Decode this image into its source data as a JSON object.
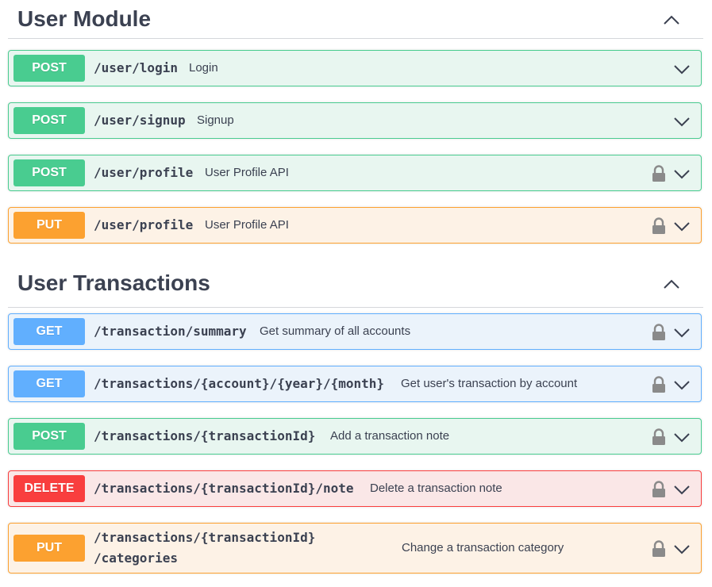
{
  "sections": [
    {
      "title": "User Module",
      "collapse_icon": "chevron-up-icon",
      "operations": [
        {
          "method": "POST",
          "path": "/user/login",
          "summary": "Login",
          "locked": false
        },
        {
          "method": "POST",
          "path": "/user/signup",
          "summary": "Signup",
          "locked": false
        },
        {
          "method": "POST",
          "path": "/user/profile",
          "summary": "User Profile API",
          "locked": true
        },
        {
          "method": "PUT",
          "path": "/user/profile",
          "summary": "User Profile API",
          "locked": true
        }
      ]
    },
    {
      "title": "User Transactions",
      "collapse_icon": "chevron-up-icon",
      "operations": [
        {
          "method": "GET",
          "path": "/transaction/summary",
          "summary": "Get summary of all accounts",
          "locked": true
        },
        {
          "method": "GET",
          "path": "/transactions/{account}/{year}/{month}",
          "summary": "Get user's transaction by account",
          "locked": true
        },
        {
          "method": "POST",
          "path": "/transactions/{transactionId}",
          "summary": "Add a transaction note",
          "locked": true
        },
        {
          "method": "DELETE",
          "path": "/transactions/{transactionId}/note",
          "summary": "Delete a transaction note",
          "locked": true
        },
        {
          "method": "PUT",
          "path_line1": "/transactions/{transactionId}",
          "path_line2": "/categories",
          "summary": "Change a transaction category",
          "locked": true
        }
      ]
    }
  ],
  "colors": {
    "post": "#49cc90",
    "put": "#fca130",
    "get": "#61affe",
    "delete": "#f93e3e"
  }
}
